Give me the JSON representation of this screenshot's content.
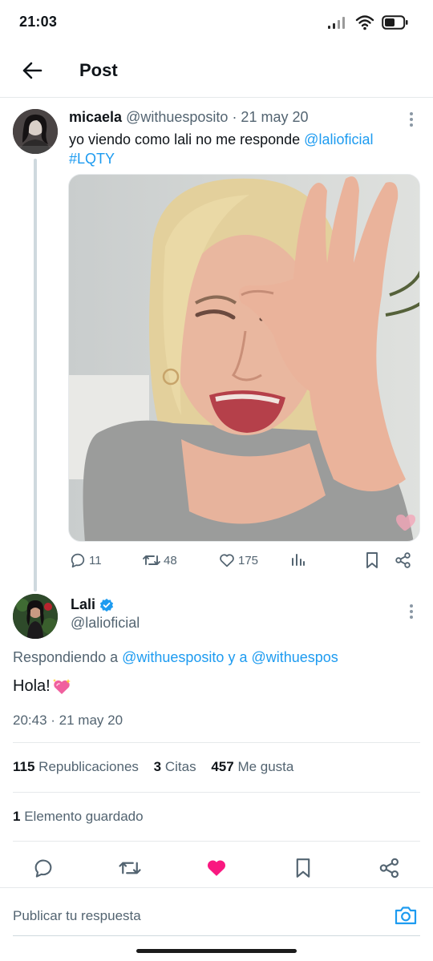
{
  "status_bar": {
    "time": "21:03",
    "icons": [
      "signal-icon",
      "wifi-icon",
      "battery-icon"
    ]
  },
  "app_bar": {
    "back_icon": "arrow-left-icon",
    "title": "Post"
  },
  "quoted_post": {
    "author_name": "micaela",
    "author_handle": "@withuesposito",
    "date": "· 21 may 20",
    "text": "yo viendo como lali no me responde ",
    "mention": "@lalioficial",
    "hashtag": "#LQTY",
    "media_icon": "photo-crying-girl",
    "actions": {
      "replies": "11",
      "reposts": "48",
      "likes": "175"
    }
  },
  "main_post": {
    "author_name": "Lali",
    "verified": true,
    "author_handle": "@lalioficial",
    "reply_prefix": "Respondiendo a ",
    "reply_mention_1": "@withuesposito",
    "reply_and": " y a ",
    "reply_mention_2": "@withuespos",
    "text": "Hola!",
    "emoji": "sparkling-heart",
    "timestamp": "20:43 · 21 may 20",
    "stats": {
      "reposts_count": "115",
      "reposts_label": "Republicaciones",
      "quotes_count": "3",
      "quotes_label": "Citas",
      "likes_count": "457",
      "likes_label": "Me gusta"
    },
    "saved_count": "1",
    "saved_label": "Elemento guardado",
    "liked": true
  },
  "reply_bar": {
    "placeholder": "Publicar tu respuesta",
    "camera_icon": "camera-icon"
  },
  "colors": {
    "accent": "#1d9bf0",
    "like": "#f91880",
    "secondary_text": "#536471",
    "divider": "#e6e9eb"
  }
}
